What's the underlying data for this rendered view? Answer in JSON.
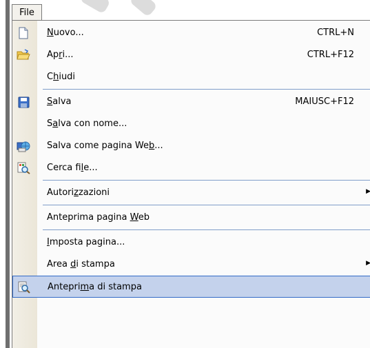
{
  "menu_title": {
    "prefix": "F",
    "rest": "ile"
  },
  "items": [
    {
      "pre": "",
      "ul": "N",
      "post": "uovo...",
      "shortcut": "CTRL+N",
      "icon": "new-document-icon"
    },
    {
      "pre": "Ap",
      "ul": "r",
      "post": "i...",
      "shortcut": "CTRL+F12",
      "icon": "open-folder-icon"
    },
    {
      "pre": "C",
      "ul": "h",
      "post": "iudi",
      "shortcut": "",
      "icon": ""
    },
    {
      "pre": "",
      "ul": "S",
      "post": "alva",
      "shortcut": "MAIUSC+F12",
      "icon": "save-disk-icon"
    },
    {
      "pre": "S",
      "ul": "a",
      "post": "lva con nome...",
      "shortcut": "",
      "icon": ""
    },
    {
      "pre": "Salva come pagina We",
      "ul": "b",
      "post": "...",
      "shortcut": "",
      "icon": "save-as-web-icon"
    },
    {
      "pre": "Cerca fi",
      "ul": "l",
      "post": "e...",
      "shortcut": "",
      "icon": "search-file-icon"
    },
    {
      "pre": "Autori",
      "ul": "z",
      "post": "zazioni",
      "shortcut": "",
      "icon": ""
    },
    {
      "pre": "Anteprima pagina ",
      "ul": "W",
      "post": "eb",
      "shortcut": "",
      "icon": ""
    },
    {
      "pre": "",
      "ul": "I",
      "post": "mposta pagina...",
      "shortcut": "",
      "icon": ""
    },
    {
      "pre": "Area ",
      "ul": "d",
      "post": "i stampa",
      "shortcut": "",
      "icon": ""
    },
    {
      "pre": "Antepri",
      "ul": "m",
      "post": "a di stampa",
      "shortcut": "",
      "icon": "print-preview-icon"
    }
  ],
  "colors": {
    "selected_bg": "#c4d2ec",
    "selected_border": "#3169c6",
    "separator": "#7f9dc9"
  }
}
